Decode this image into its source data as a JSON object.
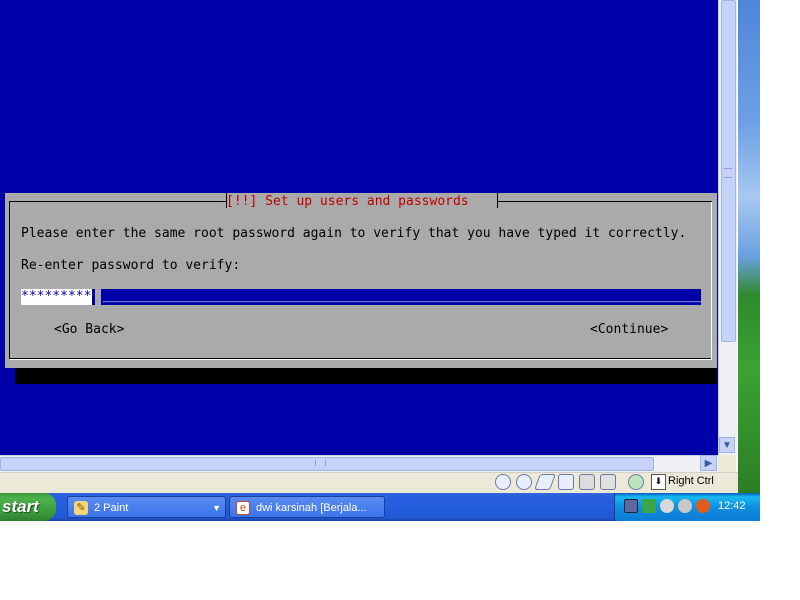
{
  "installer": {
    "title": "[!!] Set up users and passwords",
    "message": "Please enter the same root password again to verify that you have typed it correctly.",
    "prompt": "Re-enter password to verify:",
    "password_masked": "*********",
    "password_placeholder_fill": "__________________________________________________________________________________________________",
    "go_back_label": "<Go Back>",
    "continue_label": "<Continue>"
  },
  "vbox_statusbar": {
    "icons": [
      "disk-icon",
      "cd-icon",
      "usb-icon",
      "network-icon",
      "shared-folder-icon",
      "display-icon",
      "mouse-integration-icon",
      "host-key-icon"
    ],
    "host_key_label": "Right Ctrl"
  },
  "taskbar": {
    "start_label": "start",
    "tasks": [
      {
        "label": "2 Paint",
        "icon": "paint-icon"
      },
      {
        "label": "dwi karsinah [Berjala...",
        "icon": "browser-icon"
      }
    ],
    "clock": "12:42"
  },
  "colors": {
    "installer_background": "#0000a8",
    "dialog_background": "#aaaaaa",
    "title_text": "#c00000"
  }
}
